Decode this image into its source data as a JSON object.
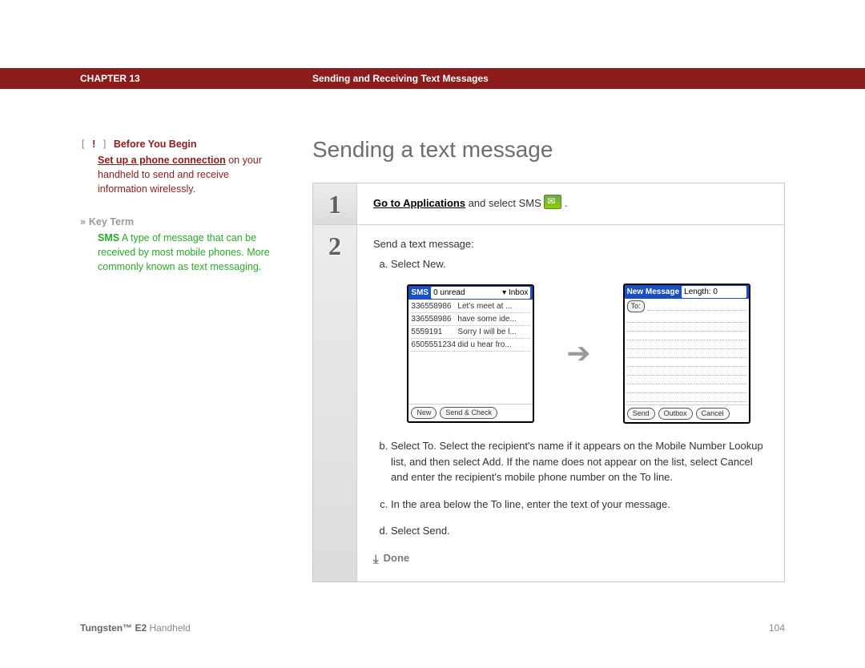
{
  "header": {
    "chapter": "CHAPTER 13",
    "title": "Sending and Receiving Text Messages"
  },
  "page_title": "Sending a text message",
  "before_you_begin": {
    "label": "Before You Begin",
    "link": "Set up a phone connection",
    "rest": " on your handheld to send and receive information wirelessly."
  },
  "key_term": {
    "label": "Key Term",
    "term": "SMS",
    "def": "   A type of message that can be received by most mobile phones. More commonly known as text messaging."
  },
  "steps": {
    "s1": {
      "num": "1",
      "link": "Go to Applications",
      "rest": " and select SMS "
    },
    "s2": {
      "num": "2",
      "intro": "Send a text message:",
      "a": "Select New.",
      "b": "Select To. Select the recipient's name if it appears on the Mobile Number Lookup list, and then select Add. If the name does not appear on the list, select Cancel and enter the recipient's mobile phone number on the To line.",
      "c": "In the area below the To line, enter the text of your message.",
      "d": "Select Send.",
      "done": "Done"
    }
  },
  "palm_inbox": {
    "app": "SMS",
    "status_left": "0 unread",
    "status_right": "▾ Inbox",
    "rows": [
      {
        "num": "336558986",
        "txt": "Let's meet at ..."
      },
      {
        "num": "336558986",
        "txt": "have some ide..."
      },
      {
        "num": "5559191",
        "txt": "Sorry I will be l..."
      },
      {
        "num": "6505551234",
        "txt": "did u hear fro..."
      }
    ],
    "btn_new": "New",
    "btn_send_check": "Send & Check"
  },
  "palm_new": {
    "app": "New Message",
    "status": "Length: 0",
    "to_label": "To:",
    "btn_send": "Send",
    "btn_outbox": "Outbox",
    "btn_cancel": "Cancel"
  },
  "footer": {
    "product_bold": "Tungsten™ E2",
    "product_rest": " Handheld",
    "page": "104"
  }
}
